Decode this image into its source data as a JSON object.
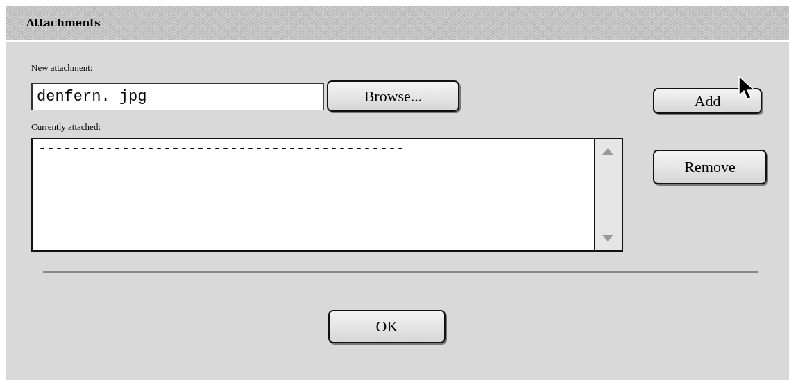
{
  "window": {
    "title": "Attachments"
  },
  "new_attachment": {
    "label": "New attachment:",
    "value": "denfern. jpg",
    "browse_button": "Browse..."
  },
  "add_button": "Add",
  "currently_attached": {
    "label": "Currently attached:",
    "items": [
      "--------------------------------------------"
    ]
  },
  "remove_button": "Remove",
  "ok_button": "OK"
}
